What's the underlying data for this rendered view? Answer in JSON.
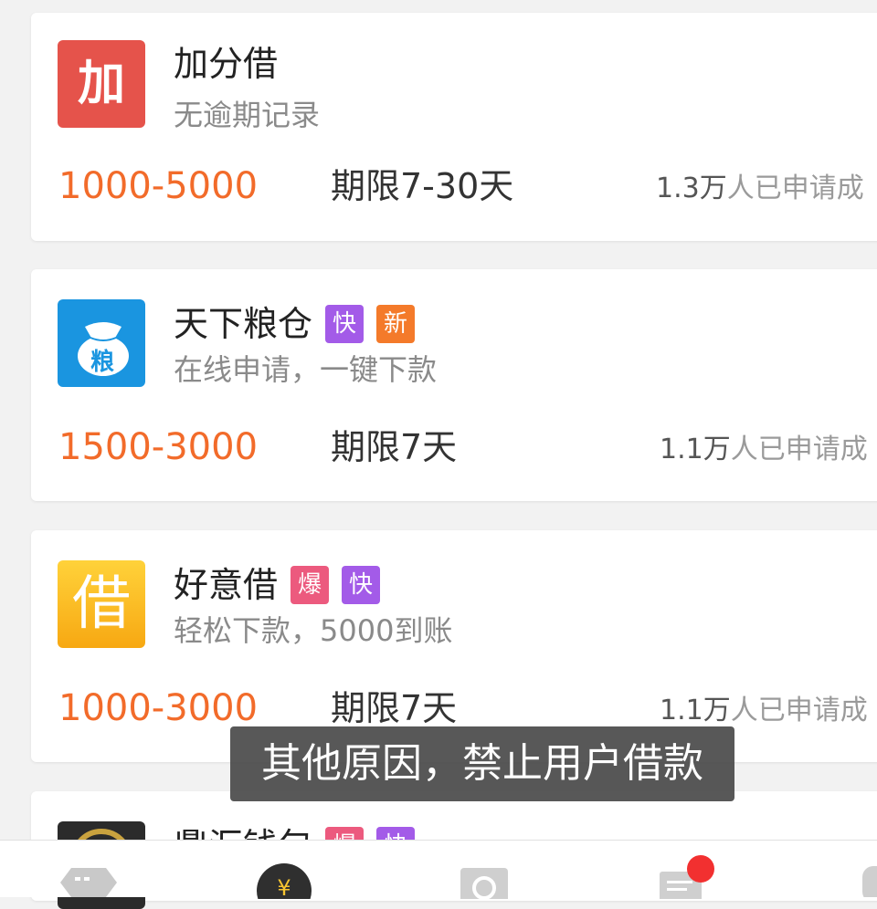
{
  "products": [
    {
      "name": "加分借",
      "logo_text": "加",
      "badges": [],
      "desc": "无逾期记录",
      "amount": "1000-5000",
      "term": "期限7-30天",
      "applied_count": "1.3万",
      "applied_suffix": "人已申请成"
    },
    {
      "name": "天下粮仓",
      "logo_text": "粮",
      "badges": [
        {
          "text": "快",
          "color": "#a35be8"
        },
        {
          "text": "新",
          "color": "#f47a2a"
        }
      ],
      "desc": "在线申请，一键下款",
      "amount": "1500-3000",
      "term": "期限7天",
      "applied_count": "1.1万",
      "applied_suffix": "人已申请成"
    },
    {
      "name": "好意借",
      "logo_text": "借",
      "badges": [
        {
          "text": "爆",
          "color": "#ec5a7e"
        },
        {
          "text": "快",
          "color": "#a35be8"
        }
      ],
      "desc": "轻松下款，5000到账",
      "amount": "1000-3000",
      "term": "期限7天",
      "applied_count": "1.1万",
      "applied_suffix": "人已申请成"
    },
    {
      "name": "鼎汇钱包",
      "badges": [
        {
          "text": "爆",
          "color": "#ec5a7e"
        },
        {
          "text": "快",
          "color": "#a35be8"
        }
      ]
    }
  ],
  "toast": "其他原因，禁止用户借款",
  "tabbar": {
    "icons": [
      "tag-icon",
      "yuan-coin-icon",
      "camera-icon",
      "news-icon",
      "profile-icon"
    ],
    "active_tab": 1,
    "notification_dot_color": "#f23030"
  },
  "colors": {
    "amount": "#f26b2a",
    "logo_jiafen": "#e5534b",
    "logo_liangcang": "#1a95e0",
    "logo_haoyi": "#f9b920"
  }
}
